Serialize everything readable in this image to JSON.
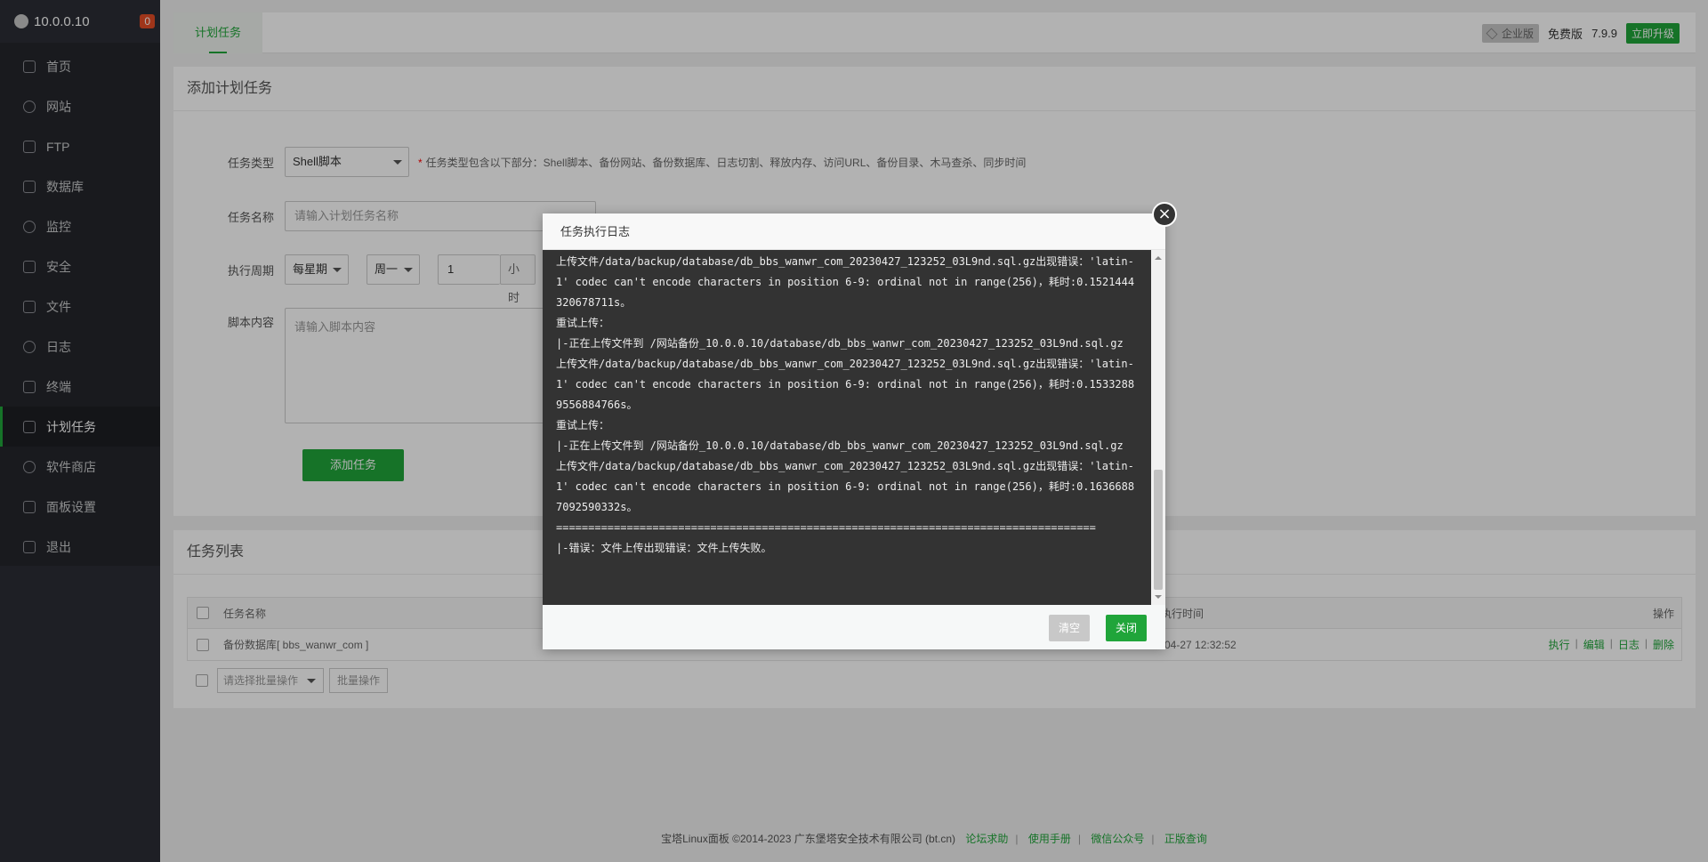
{
  "sidebar": {
    "ip": "10.0.0.10",
    "badge": "0",
    "items": [
      {
        "label": "首页",
        "icon": "home-icon"
      },
      {
        "label": "网站",
        "icon": "globe-icon"
      },
      {
        "label": "FTP",
        "icon": "ftp-icon"
      },
      {
        "label": "数据库",
        "icon": "database-icon"
      },
      {
        "label": "监控",
        "icon": "monitor-icon"
      },
      {
        "label": "安全",
        "icon": "shield-icon"
      },
      {
        "label": "文件",
        "icon": "folder-icon"
      },
      {
        "label": "日志",
        "icon": "log-icon"
      },
      {
        "label": "终端",
        "icon": "terminal-icon"
      },
      {
        "label": "计划任务",
        "icon": "calendar-icon",
        "active": true
      },
      {
        "label": "软件商店",
        "icon": "grid-icon"
      },
      {
        "label": "面板设置",
        "icon": "gear-icon"
      },
      {
        "label": "退出",
        "icon": "logout-icon"
      }
    ]
  },
  "topbar": {
    "tab": "计划任务",
    "edition": "企业版",
    "free": "免费版",
    "version": "7.9.9",
    "upgrade": "立即升级"
  },
  "add_panel": {
    "title": "添加计划任务",
    "type_label": "任务类型",
    "type_value": "Shell脚本",
    "type_hint": "任务类型包含以下部分：Shell脚本、备份网站、备份数据库、日志切割、释放内存、访问URL、备份目录、木马查杀、同步时间",
    "name_label": "任务名称",
    "name_placeholder": "请输入计划任务名称",
    "cycle_label": "执行周期",
    "cycle_value": "每星期",
    "weekday_value": "周一",
    "hour_value": "1",
    "hour_unit": "小时",
    "script_label": "脚本内容",
    "script_placeholder": "请输入脚本内容",
    "add_button": "添加任务"
  },
  "list_panel": {
    "title": "任务列表",
    "col_name": "任务名称",
    "col_time": "执行时间",
    "col_ops": "操作",
    "rows": [
      {
        "name": "备份数据库[ bbs_wanwr_com ]",
        "time": "-04-27 12:32:52"
      }
    ],
    "ops": [
      "执行",
      "编辑",
      "日志",
      "删除"
    ],
    "batch_placeholder": "请选择批量操作",
    "batch_button": "批量操作"
  },
  "modal": {
    "title": "任务执行日志",
    "lines": [
      "上传文件/data/backup/database/db_bbs_wanwr_com_20230427_123252_03L9nd.sql.gz出现错误：'latin-1' codec can't encode characters in position 6-9: ordinal not in range(256)，耗时:0.1521444320678711s。",
      "重试上传：",
      "|-正在上传文件到 /网站备份_10.0.0.10/database/db_bbs_wanwr_com_20230427_123252_03L9nd.sql.gz",
      "上传文件/data/backup/database/db_bbs_wanwr_com_20230427_123252_03L9nd.sql.gz出现错误：'latin-1' codec can't encode characters in position 6-9: ordinal not in range(256)，耗时:0.15332889556884766s。",
      "重试上传：",
      "|-正在上传文件到 /网站备份_10.0.0.10/database/db_bbs_wanwr_com_20230427_123252_03L9nd.sql.gz",
      "上传文件/data/backup/database/db_bbs_wanwr_com_20230427_123252_03L9nd.sql.gz出现错误：'latin-1' codec can't encode characters in position 6-9: ordinal not in range(256)，耗时:0.16366887092590332s。",
      "====================================================================================",
      "|-错误：文件上传出现错误：文件上传失败。"
    ],
    "clear_button": "清空",
    "close_button": "关闭",
    "close_icon": "×"
  },
  "footer": {
    "copyright": "宝塔Linux面板 ©2014-2023 广东堡塔安全技术有限公司 (bt.cn)",
    "links": [
      "论坛求助",
      "使用手册",
      "微信公众号",
      "正版查询"
    ]
  },
  "colors": {
    "accent": "#20a53a",
    "sidebar": "#2b2d35",
    "log_bg": "#333333"
  }
}
